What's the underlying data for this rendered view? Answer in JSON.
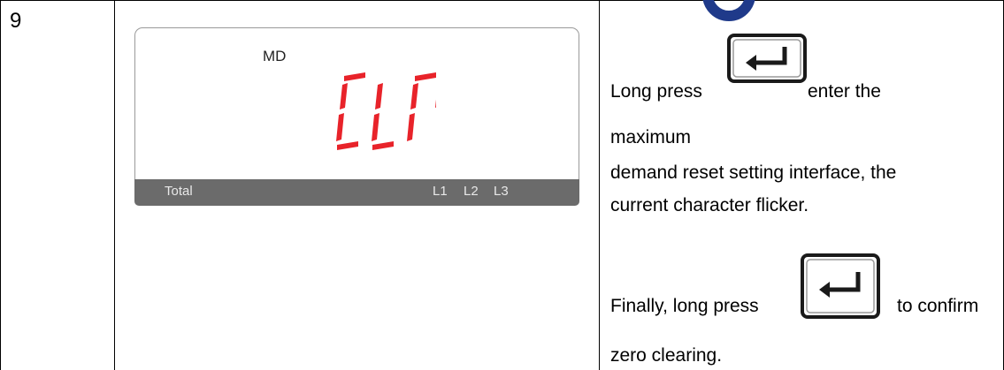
{
  "row": {
    "step_number": "9"
  },
  "lcd": {
    "mode_label": "MD",
    "display_text": "CLR",
    "total_label": "Total",
    "phases": [
      "L1",
      "L2",
      "L3"
    ],
    "segment_color": "#e8232a",
    "bar_color": "#6b6b6b"
  },
  "instructions": {
    "line1": "Long press",
    "line1_after": "enter the",
    "line2": "maximum",
    "line3": "demand reset setting interface, the",
    "line4": "current character flicker.",
    "line5": "Finally, long press",
    "line5_after": "to confirm",
    "line6": "zero clearing."
  },
  "icons": {
    "enter_key": "enter-key-icon",
    "logo": "brand-logo-icon"
  }
}
